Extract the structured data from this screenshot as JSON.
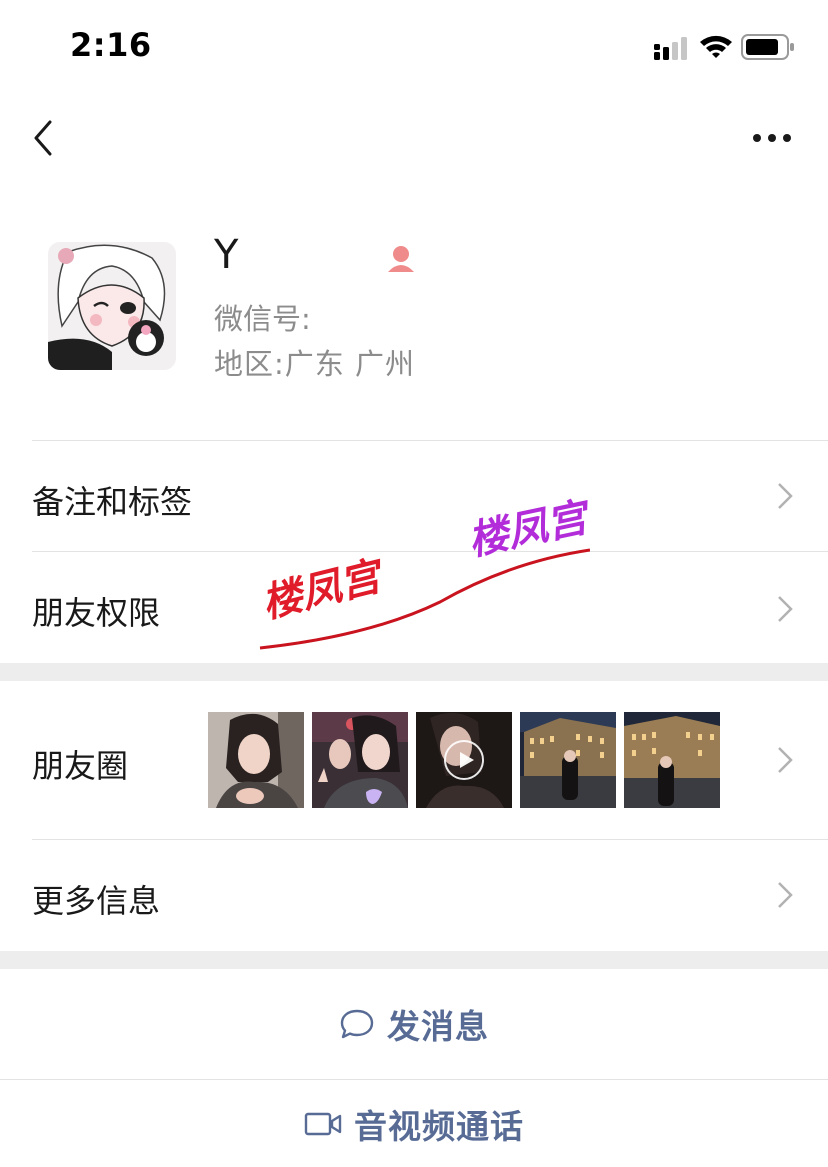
{
  "status_bar": {
    "time": "2:16"
  },
  "profile": {
    "name": "Y",
    "wechat_id_label": "微信号:",
    "wechat_id_value": "",
    "region_label": "地区:",
    "region_value": "广东 广州"
  },
  "rows": {
    "remark_tags": "备注和标签",
    "friend_permissions": "朋友权限",
    "moments": "朋友圈",
    "more_info": "更多信息"
  },
  "watermark": {
    "text_red": "楼凤宫",
    "text_purple": "楼凤宫"
  },
  "actions": {
    "send_message": "发消息",
    "av_call": "音视频通话"
  },
  "colors": {
    "link_blue": "#576b95",
    "divider": "#e3e3e3",
    "band": "#ededed",
    "secondary_text": "#8c8c8c"
  }
}
